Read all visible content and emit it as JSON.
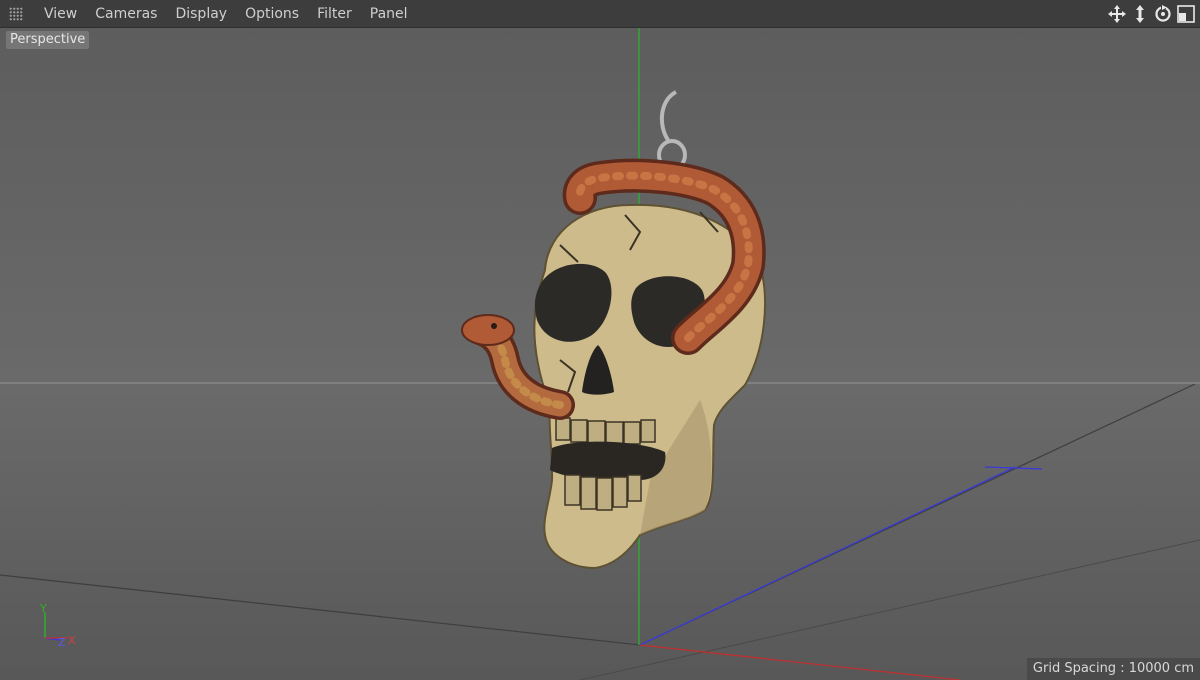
{
  "menu": {
    "items": [
      {
        "label": "View"
      },
      {
        "label": "Cameras"
      },
      {
        "label": "Display"
      },
      {
        "label": "Options"
      },
      {
        "label": "Filter"
      },
      {
        "label": "Panel"
      }
    ]
  },
  "nav_icons": [
    "move-view-icon",
    "zoom-view-icon",
    "rotate-view-icon",
    "toggle-layout-icon"
  ],
  "viewport": {
    "camera_label": "Perspective",
    "grid_spacing": "Grid Spacing : 10000 cm",
    "axis_gizmo": {
      "y": "Y",
      "z": "Z",
      "x": "X"
    },
    "model": "skull-with-snake-pendant",
    "colors": {
      "y_axis": "#2fae2f",
      "x_axis": "#c03030",
      "z_axis": "#3a3ad8",
      "horizon": "#8a8a8a",
      "bone": "#cdbb8c",
      "snake": "#b05a36"
    }
  }
}
